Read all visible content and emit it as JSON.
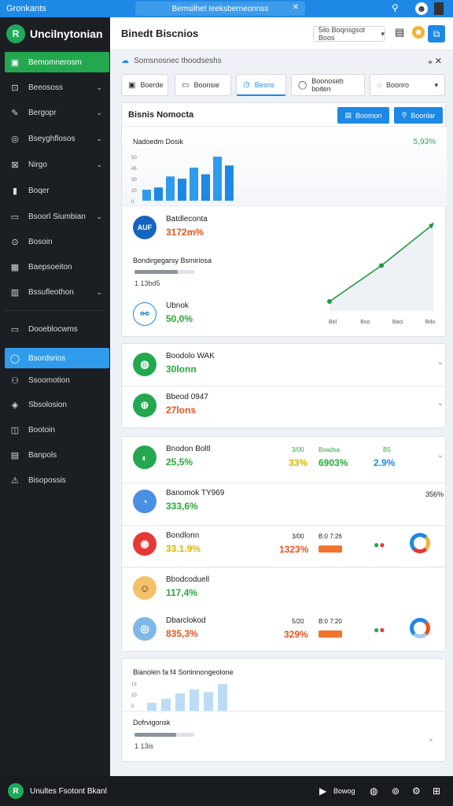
{
  "topbar": {
    "title": "Gronkants",
    "tab_label": "Bemsilhet Ieeksberneonnss",
    "tab_close": "✕",
    "search_icon": "⚲",
    "avatar_icon": "☻",
    "menu_icon": "▪"
  },
  "sidebar": {
    "brand": "Uncilnytonian",
    "items": [
      {
        "label": "Bemomnerosm",
        "icon": "▣",
        "chevron": false,
        "state": "green"
      },
      {
        "label": "Beeososs",
        "icon": "⊡",
        "chevron": true
      },
      {
        "label": "Bergopr",
        "icon": "✎",
        "chevron": true
      },
      {
        "label": "Bseyghflosos",
        "icon": "◎",
        "chevron": true
      },
      {
        "label": "Nirgo",
        "icon": "⊠",
        "chevron": true
      },
      {
        "label": "Boqer",
        "icon": "▮",
        "chevron": false
      },
      {
        "label": "Bsoorl Siumbian",
        "icon": "▭",
        "chevron": true
      },
      {
        "label": "Bosoin",
        "icon": "⊙",
        "chevron": false
      },
      {
        "label": "Baepsoeiton",
        "icon": "▦",
        "chevron": false
      },
      {
        "label": "Bssufleothon",
        "icon": "▥",
        "chevron": true
      },
      {
        "label": "Dooeblocwms",
        "icon": "▭",
        "chevron": false
      },
      {
        "label": "Bsordsrios",
        "icon": "◯",
        "chevron": false,
        "state": "blue"
      },
      {
        "label": "Ssoomotion",
        "icon": "⚇",
        "chevron": false
      },
      {
        "label": "Sbsolosion",
        "icon": "◈",
        "chevron": false
      },
      {
        "label": "Bootoin",
        "icon": "◫",
        "chevron": false
      },
      {
        "label": "Banpols",
        "icon": "▤",
        "chevron": false
      },
      {
        "label": "Bisopossis",
        "icon": "⚠",
        "chevron": false
      }
    ]
  },
  "header": {
    "title": "Binedt Biscnios",
    "select_label": "5ilo Boqnsgsot Boos",
    "select_arrow": "▾",
    "calendar_icon": "▤",
    "avatar_icon": "☻",
    "button_icon": "⧉"
  },
  "subbar": {
    "label": "Somsnosnec thoodseshs",
    "icon": "☁",
    "close": "⁎ ✕"
  },
  "tabs": [
    {
      "label": "Boerde",
      "icon": "▣"
    },
    {
      "label": "Boonsie",
      "icon": "▭"
    },
    {
      "label": "Besns",
      "icon": "◷",
      "active": true
    },
    {
      "label": "Boonoseb boiten",
      "icon": "◯"
    },
    {
      "label": "Boonro",
      "icon": "◌",
      "chevron": "▾"
    }
  ],
  "card1": {
    "title": "Bisnis Nomocta",
    "btn1": "Boomon",
    "btn2": "Boonlar",
    "chart_title": "Nadoedm Dosik",
    "chart_pct": "5,93%",
    "yticks": [
      "50",
      "45",
      "30",
      "20",
      "0"
    ],
    "bars": [
      0.25,
      0.3,
      0.55,
      0.5,
      0.75,
      0.6,
      1.0,
      0.8
    ],
    "metric1": {
      "label": "Batdleconta",
      "value": "3172m%",
      "avatar": "AUF"
    },
    "progress_label": "Bondirgegarsy Bsmiriosa",
    "progress_value": 0.72,
    "progress_text": "1  13bd5",
    "metric2": {
      "label": "Ubnok",
      "value": "50,0%",
      "avatar": "⚯"
    },
    "line_chart": {
      "type": "line",
      "x": [
        "Bol",
        "Bso",
        "Baci",
        "Bdo"
      ],
      "values": [
        10,
        48,
        92
      ],
      "color": "#1f9a3f"
    }
  },
  "card2": {
    "rows": [
      {
        "label": "Boodolo WAK",
        "value": "30lonn",
        "avatar": "◍",
        "color": "green"
      },
      {
        "label": "Bbeod 0947",
        "value": "27lons",
        "avatar": "⊕",
        "color": "orange"
      }
    ]
  },
  "card3": {
    "rows": [
      {
        "label": "Bnodon Boltl",
        "value": "25,5%",
        "valColor": "green",
        "avatar": "◐",
        "avatarBg": "#23a84f",
        "c1": "3/00",
        "c1Color": "green",
        "c2": "33%",
        "c2Color": "yellow",
        "c3head": "Boadsa",
        "c3": "6903%",
        "c3Color": "green",
        "c4head": "B5",
        "c4": "2.9%",
        "c4Color": "blue"
      },
      {
        "label": "Banomok TY969",
        "value": "333,6%",
        "valColor": "green",
        "avatar": "◔",
        "avatarBg": "#4a90e2",
        "cright": "356%"
      },
      {
        "label": "Bondlonn",
        "value": "33.1.9%",
        "valColor": "yellow",
        "avatar": "◉",
        "avatarBg": "#e53935",
        "c1": "3/00",
        "c2": "1323%",
        "c2Color": "orange",
        "c3head": "B:0 7:26"
      }
    ]
  },
  "card4": {
    "rows": [
      {
        "label": "Bbodcoduell",
        "value": "117,4%",
        "valColor": "green",
        "avatar": "☺",
        "avatarBg": "#f5c06b"
      },
      {
        "label": "Dbarclokod",
        "value": "835,3%",
        "valColor": "orange",
        "avatar": "◎",
        "avatarBg": "#7fb8e6",
        "c1": "5/20",
        "c2": "329%",
        "c2Color": "orange",
        "c3head": "B:0 7:20"
      }
    ]
  },
  "card5": {
    "title": "Bianolen fa f4 Soriinnongeolone",
    "yticks": [
      "15",
      "10",
      "5"
    ],
    "bars": [
      0.3,
      0.45,
      0.65,
      0.8,
      0.7,
      1.0
    ],
    "progress_label": "Dofrvigonsk",
    "progress_value": 0.7,
    "progress_text": "1  13is"
  },
  "bottombar": {
    "label": "Unultes Fsotont Bkanl",
    "play_label": "Bowog"
  },
  "colors": {
    "accent": "#1e88e5",
    "green": "#23a84f",
    "orange": "#e8531e",
    "sidebar": "#1b1f24"
  }
}
